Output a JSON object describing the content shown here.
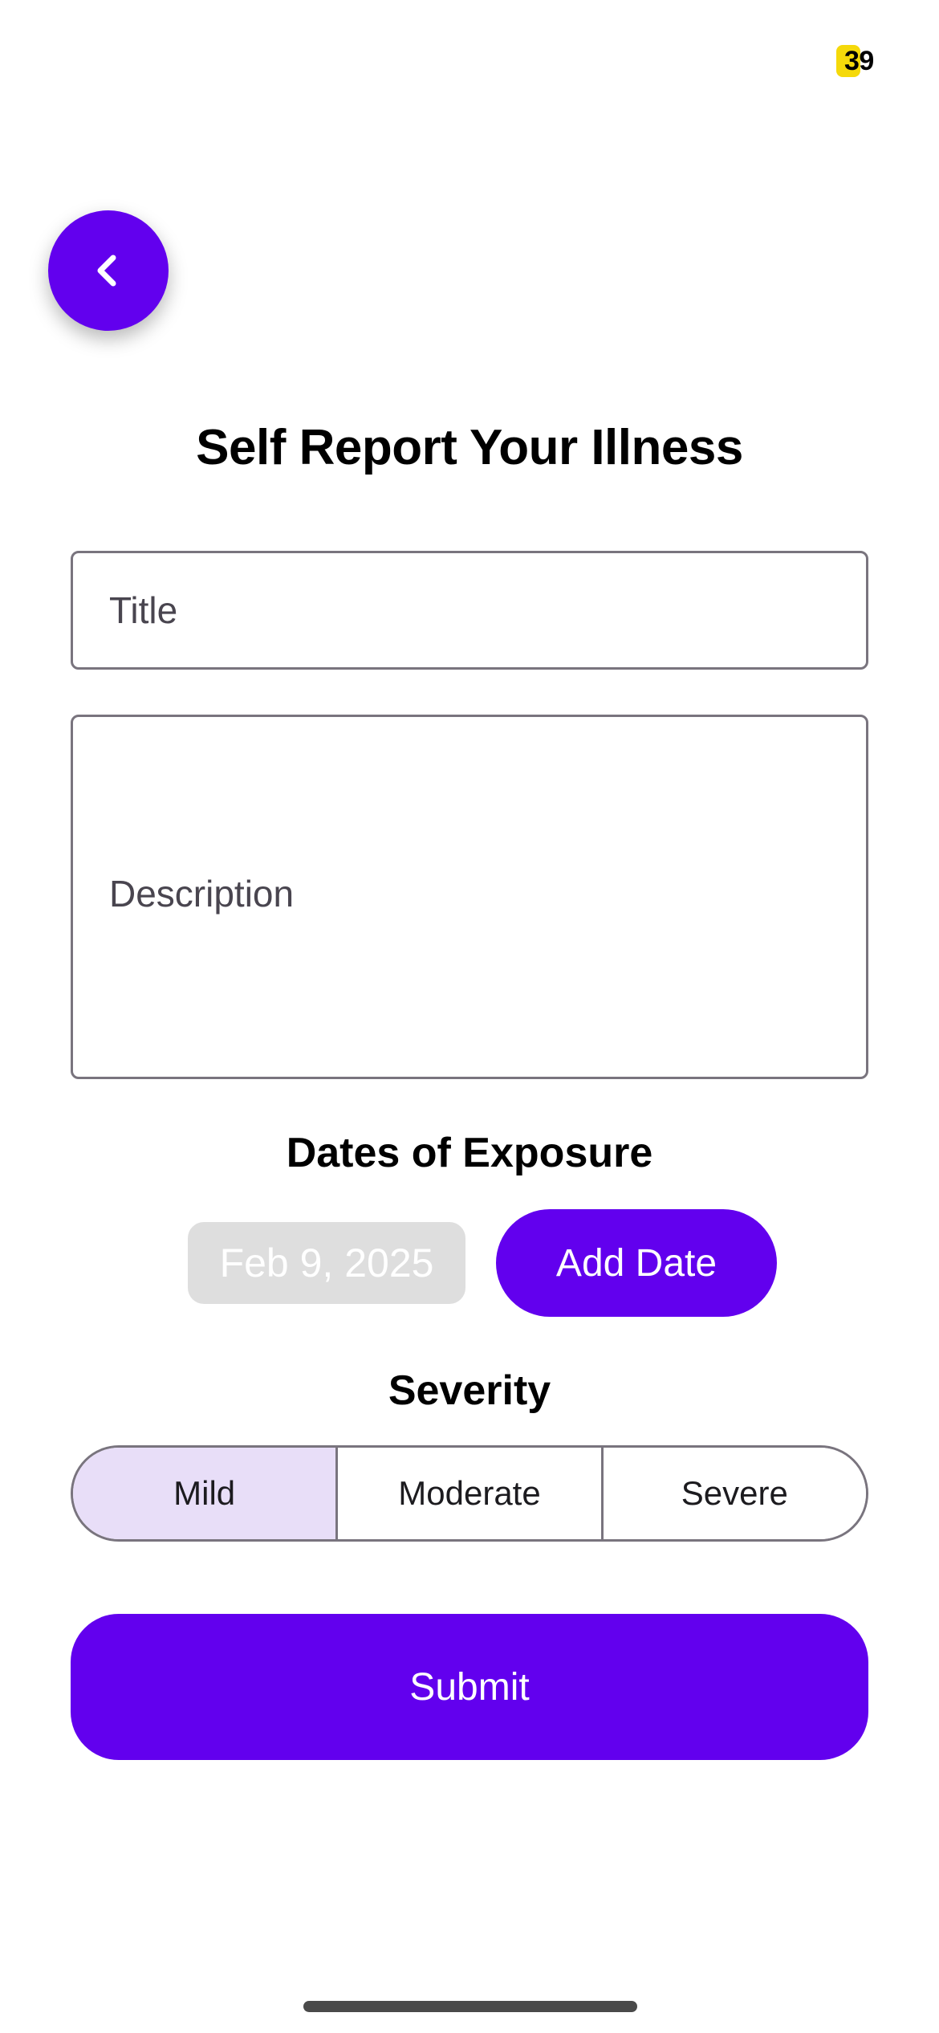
{
  "status_bar": {
    "badge_text": "39",
    "badge_color": "#f5d90a"
  },
  "header": {
    "back_icon": "chevron-left-icon",
    "title": "Self Report Your Illness"
  },
  "form": {
    "title_placeholder": "Title",
    "title_value": "",
    "description_placeholder": "Description",
    "description_value": ""
  },
  "exposure": {
    "heading": "Dates of Exposure",
    "date_value": "Feb 9, 2025",
    "add_date_label": "Add Date"
  },
  "severity": {
    "heading": "Severity",
    "options": [
      "Mild",
      "Moderate",
      "Severe"
    ],
    "selected": "Mild"
  },
  "submit_label": "Submit",
  "colors": {
    "accent": "#6200ee",
    "selected_segment": "#e8def8",
    "outline": "#79747e",
    "disabled_chip": "#dedede"
  }
}
